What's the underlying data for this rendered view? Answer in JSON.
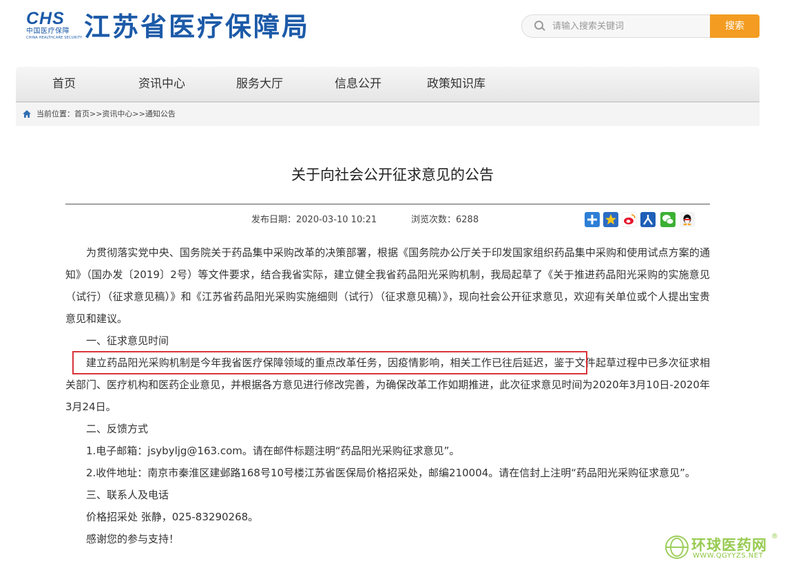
{
  "header": {
    "logo_mark": "CHS",
    "logo_cn": "中国医疗保障",
    "logo_en": "CHINA HEALTHCARE SECURITY",
    "site_title": "江苏省医疗保障局",
    "search_placeholder": "请输入搜索关键词",
    "search_button": "搜索"
  },
  "nav": {
    "items": [
      {
        "label": "首页"
      },
      {
        "label": "资讯中心"
      },
      {
        "label": "服务大厅"
      },
      {
        "label": "信息公开"
      },
      {
        "label": "政策知识库"
      }
    ]
  },
  "breadcrumb": {
    "text": "当前位置：首页>>资讯中心>>通知公告"
  },
  "article": {
    "title": "关于向社会公开征求意见的公告",
    "publish_date": "发布日期：2020-03-10 10:21",
    "views": "浏览次数：6288",
    "paragraphs": [
      "为贯彻落实党中央、国务院关于药品集中采购改革的决策部署，根据《国务院办公厅关于印发国家组织药品集中采购和使用试点方案的通知》（国办发〔2019〕2号）等文件要求，结合我省实际，建立健全我省药品阳光采购机制，我局起草了《关于推进药品阳光采购的实施意见（试行）（征求意见稿）》和《江苏省药品阳光采购实施细则（试行）（征求意见稿）》，现向社会公开征求意见，欢迎有关单位或个人提出宝贵意见和建议。",
      "一、征求意见时间",
      "建立药品阳光采购机制是今年我省医疗保障领域的重点改革任务，因疫情影响，相关工作已往后延迟，鉴于文件起草过程中已多次征求相关部门、医疗机构和医药企业意见，并根据各方意见进行修改完善，为确保改革工作如期推进，此次征求意见时间为2020年3月10日-2020年3月24日。",
      "二、反馈方式",
      "1.电子邮箱：jsybyljg@163.com。请在邮件标题注明“药品阳光采购征求意见”。",
      "2.收件地址：南京市秦淮区建邺路168号10号楼江苏省医保局价格招采处，邮编210004。请在信封上注明“药品阳光采购征求意见”。",
      "三、联系人及电话",
      "价格招采处 张静，025-83290268。",
      "感谢您的参与支持！"
    ]
  },
  "share_icons": [
    "plus-share-icon",
    "qzone-star-icon",
    "weibo-icon",
    "renren-icon",
    "wechat-icon",
    "qq-icon"
  ],
  "watermark": {
    "name": "环球医药网",
    "reg": "®",
    "url": "WWW.QGYYZS.NET"
  },
  "colors": {
    "brand_blue": "#1c5aa8",
    "search_orange": "#f39c21",
    "highlight_red": "#d9333a",
    "watermark_green": "#8cc63f"
  }
}
